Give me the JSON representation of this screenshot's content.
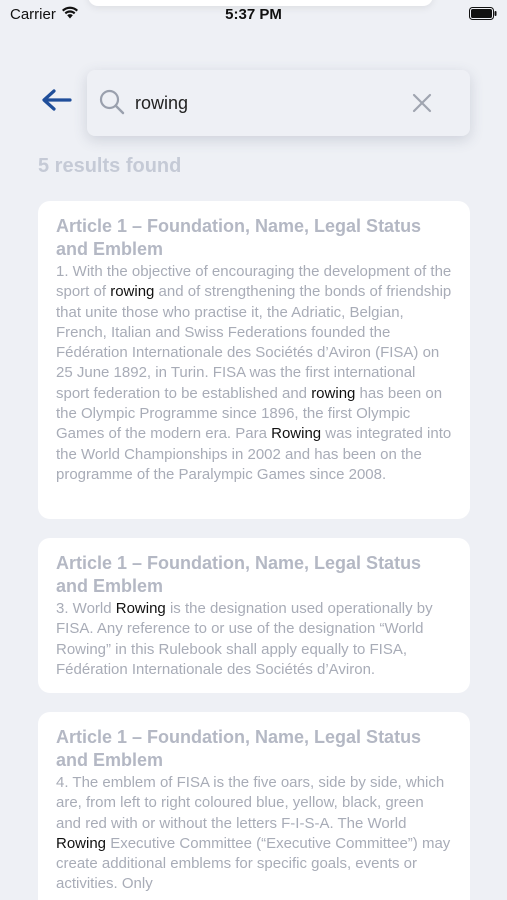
{
  "status_bar": {
    "carrier": "Carrier",
    "time": "5:37 PM"
  },
  "search": {
    "value": "rowing",
    "placeholder": ""
  },
  "results_count": "5 results found",
  "results": [
    {
      "title": "Article 1 – Foundation, Name, Legal Status and Emblem",
      "segments": [
        {
          "t": "1. With the objective of encouraging the development of the sport of ",
          "h": false
        },
        {
          "t": "rowing",
          "h": true
        },
        {
          "t": " and of strengthening the bonds of friendship that unite those who practise it, the Adriatic, Belgian, French, Italian and Swiss Federations founded the Fédération Internationale des Sociétés d’Aviron (FISA) on 25 June 1892, in Turin. FISA was the first international sport federation to be established and ",
          "h": false
        },
        {
          "t": "rowing",
          "h": true
        },
        {
          "t": " has been on the Olympic Programme since 1896, the first Olympic Games of the modern era. Para ",
          "h": false
        },
        {
          "t": "Rowing",
          "h": true
        },
        {
          "t": " was integrated into the World Championships in 2002 and has been on the programme of the Paralympic Games since 2008.",
          "h": false
        }
      ]
    },
    {
      "title": "Article 1 – Foundation, Name, Legal Status and Emblem",
      "segments": [
        {
          "t": "3. World ",
          "h": false
        },
        {
          "t": "Rowing",
          "h": true
        },
        {
          "t": " is the designation used operationally by FISA. Any reference to or use of the designation “World Rowing” in this Rulebook shall apply equally to FISA, Fédération Internationale des Sociétés d’Aviron.",
          "h": false
        }
      ]
    },
    {
      "title": "Article 1 – Foundation, Name, Legal Status and Emblem",
      "segments": [
        {
          "t": "4. The emblem of FISA is the five oars, side by side, which are, from left to right coloured blue, yellow, black, green and red with or without the letters F-I-S-A. The World ",
          "h": false
        },
        {
          "t": "Rowing",
          "h": true
        },
        {
          "t": " Executive Committee (“Executive Committee”) may create additional emblems for specific goals, events or activities. Only",
          "h": false
        }
      ]
    }
  ],
  "colors": {
    "accent": "#1f4e9a",
    "background": "#eef0f5",
    "card": "#ffffff",
    "muted_text": "#a8acb7",
    "highlight_text": "#111111"
  },
  "icons": {
    "back": "arrow-left-icon",
    "search": "magnifier-icon",
    "clear": "close-icon",
    "wifi": "wifi-icon",
    "battery": "battery-icon"
  }
}
